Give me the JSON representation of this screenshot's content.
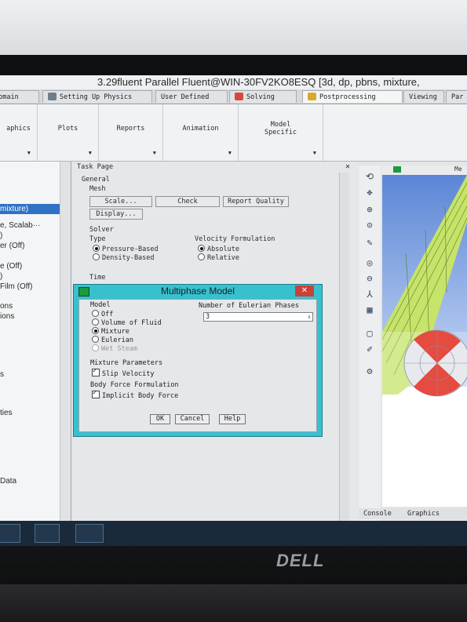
{
  "window": {
    "title": "3.29fluent Parallel Fluent@WIN-30FV2KO8ESQ [3d, dp, pbns, mixture,"
  },
  "tabs": [
    {
      "label": "Domain"
    },
    {
      "label": "Setting Up Physics"
    },
    {
      "label": "User Defined"
    },
    {
      "label": "Solving"
    },
    {
      "label": "Postprocessing"
    },
    {
      "label": "Viewing"
    },
    {
      "label": "Par"
    }
  ],
  "ribbon": {
    "graphics": "aphics",
    "plots": "Plots",
    "reports": "Reports",
    "animation": "Animation",
    "model_specific": "Model\nSpecific"
  },
  "tree": {
    "items": [
      {
        "label": "mixture)"
      },
      {
        "label": "e, Scalab···"
      },
      {
        "label": ")"
      },
      {
        "label": "er (Off)"
      },
      {
        "label": "e (Off)"
      },
      {
        "label": ")"
      },
      {
        "label": "Film (Off)"
      },
      {
        "label": "ons"
      },
      {
        "label": "ions"
      },
      {
        "label": "s"
      },
      {
        "label": "ties"
      },
      {
        "label": "Data"
      }
    ]
  },
  "task_page": {
    "header": "Task Page",
    "general": "General",
    "mesh": "Mesh",
    "scale": "Scale...",
    "check": "Check",
    "report_quality": "Report Quality",
    "display": "Display...",
    "solver": "Solver",
    "type_label": "Type",
    "pressure_based": "Pressure-Based",
    "density_based": "Density-Based",
    "velocity_formulation": "Velocity Formulation",
    "absolute": "Absolute",
    "relative": "Relative",
    "time": "Time"
  },
  "dialog": {
    "title": "Multiphase Model",
    "model_label": "Model",
    "options": [
      {
        "label": "Off",
        "selected": false
      },
      {
        "label": "Volume of Fluid",
        "selected": false
      },
      {
        "label": "Mixture",
        "selected": true
      },
      {
        "label": "Eulerian",
        "selected": false
      },
      {
        "label": "Wet Steam",
        "selected": false
      }
    ],
    "num_phases_label": "Number of Eulerian Phases",
    "num_phases_value": "3",
    "mixture_params": "Mixture Parameters",
    "slip_velocity": "Slip Velocity",
    "body_force": "Body Force Formulation",
    "implicit_body_force": "Implicit Body Force",
    "ok": "OK",
    "cancel": "Cancel",
    "help": "Help"
  },
  "graphics_panel": {
    "header": "Me",
    "console_tab": "Console",
    "graphics_tab": "Graphics"
  },
  "brand": "DELL",
  "colors": {
    "dialog_frame": "#37c1cf",
    "selection": "#2f72c4",
    "mesh_green": "#c6e36a",
    "mesh_red": "#e54b3f"
  }
}
